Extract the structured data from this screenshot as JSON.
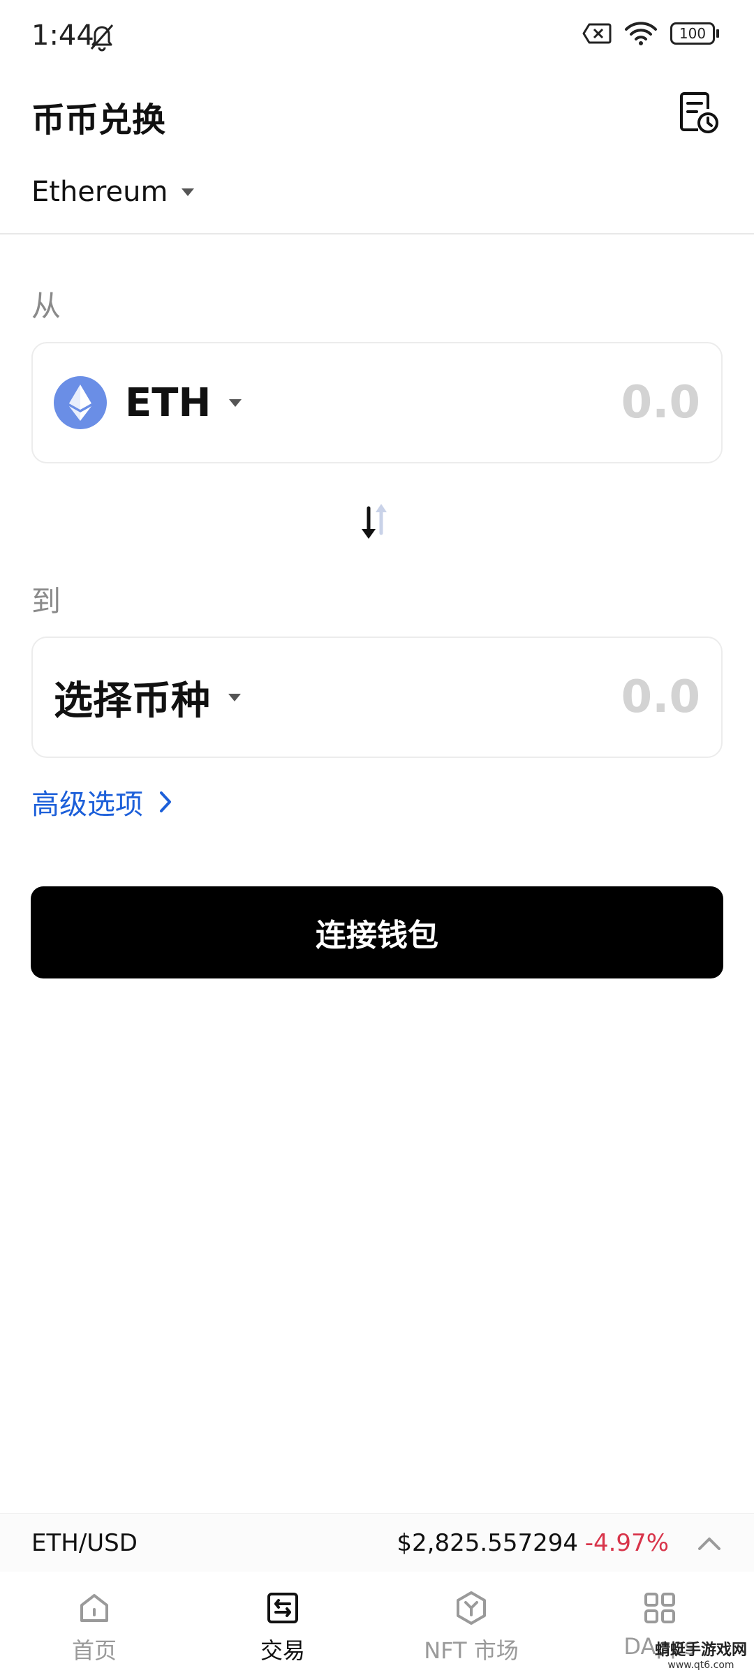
{
  "status_bar": {
    "time": "1:44",
    "battery": "100"
  },
  "header": {
    "title": "币币兑换"
  },
  "network": {
    "label": "Ethereum"
  },
  "from": {
    "label": "从",
    "token": "ETH",
    "amount_placeholder": "0.0"
  },
  "to": {
    "label": "到",
    "token": "选择币种",
    "amount_placeholder": "0.0"
  },
  "advanced": {
    "label": "高级选项"
  },
  "connect": {
    "label": "连接钱包"
  },
  "ticker": {
    "pair": "ETH/USD",
    "price": "$2,825.557294",
    "change": "-4.97%",
    "change_color": "#d8344a"
  },
  "nav": {
    "items": [
      {
        "label": "首页",
        "icon": "home-icon"
      },
      {
        "label": "交易",
        "icon": "trade-icon"
      },
      {
        "label": "NFT 市场",
        "icon": "nft-market-icon"
      },
      {
        "label": "DApps",
        "icon": "dapps-grid-icon"
      }
    ]
  },
  "watermark": {
    "title": "蜻蜓手游戏网",
    "url": "www.qt6.com"
  },
  "colors": {
    "accent_link": "#1c5fd9",
    "primary_button": "#000000",
    "eth_logo": "#6a8ee6"
  }
}
